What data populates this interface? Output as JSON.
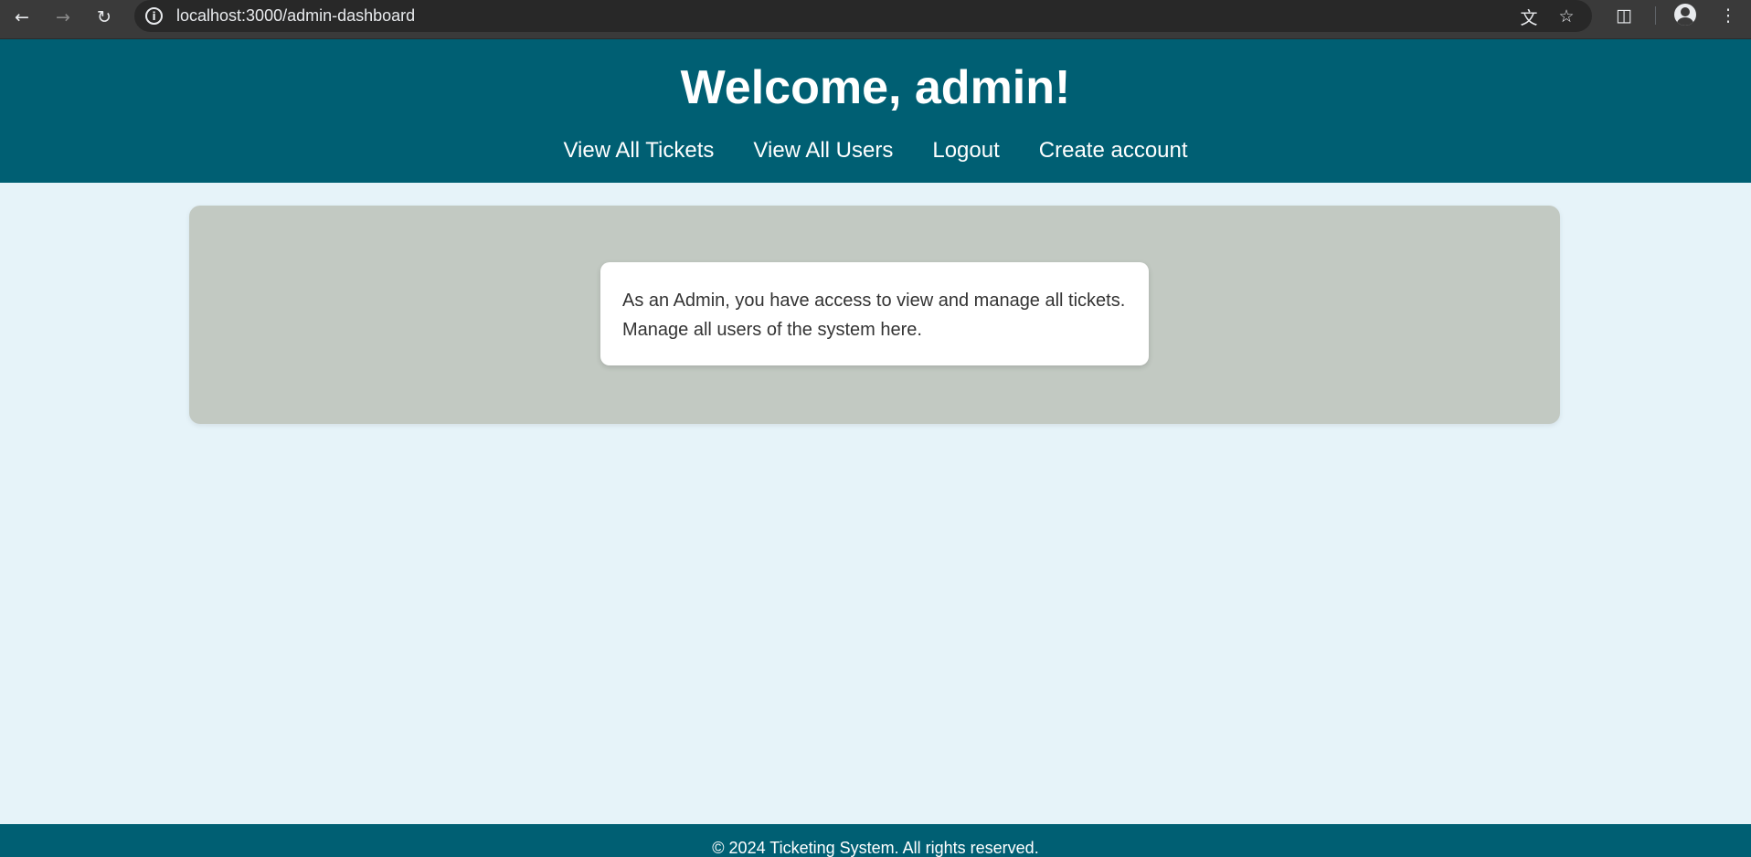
{
  "browser": {
    "url": "localhost:3000/admin-dashboard",
    "icons": {
      "back": "back-arrow-icon",
      "forward": "forward-arrow-icon",
      "reload": "reload-icon",
      "site_info": "site-info-icon",
      "translate": "translate-icon",
      "bookmark": "star-icon",
      "extensions": "puzzle-icon",
      "profile": "profile-avatar-icon",
      "menu": "kebab-menu-icon"
    }
  },
  "header": {
    "title": "Welcome, admin!",
    "nav": [
      {
        "label": "View All Tickets"
      },
      {
        "label": "View All Users"
      },
      {
        "label": "Logout"
      },
      {
        "label": "Create account"
      }
    ]
  },
  "main": {
    "card_lines": [
      "As an Admin, you have access to view and manage all tickets.",
      "Manage all users of the system here."
    ]
  },
  "footer": {
    "text": "© 2024 Ticketing System. All rights reserved."
  },
  "colors": {
    "header_bg": "#005f73",
    "page_bg": "#e6f3f9",
    "panel_bg": "#c2c9c2",
    "card_bg": "#ffffff",
    "browser_bar_bg": "#3a3a3a"
  }
}
